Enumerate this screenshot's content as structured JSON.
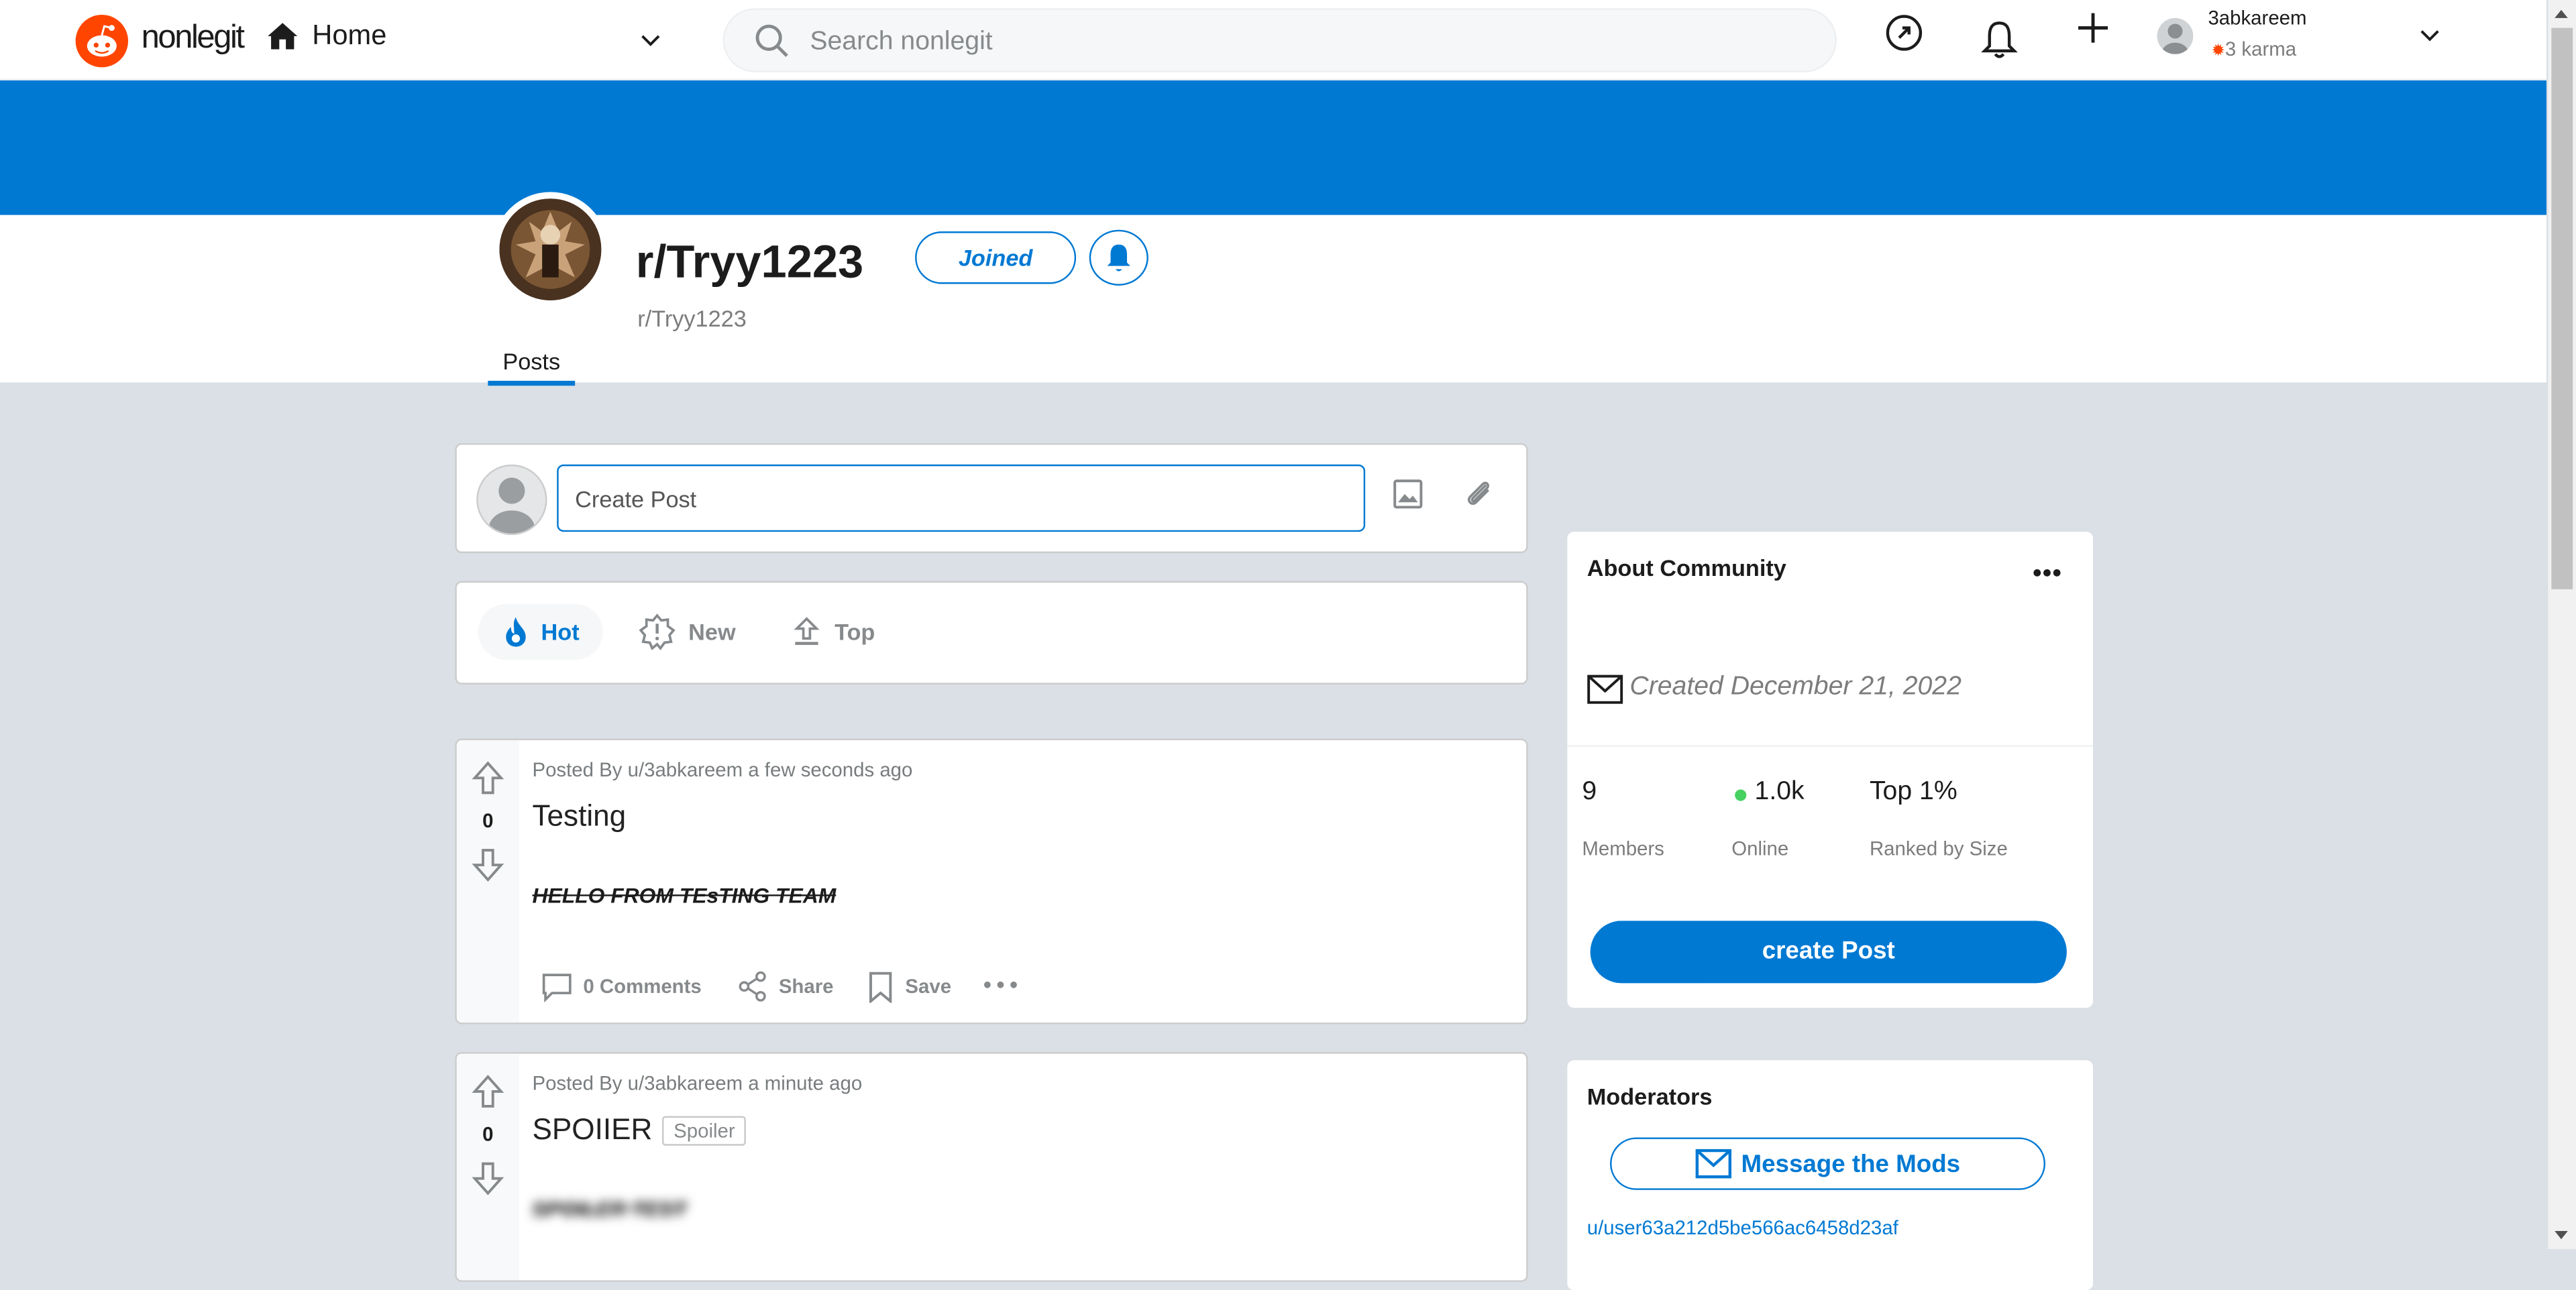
{
  "header": {
    "logo_text": "nonlegit",
    "home_label": "Home",
    "search_placeholder": "Search nonlegit",
    "username": "3abkareem",
    "karma": "3 karma"
  },
  "community": {
    "title": "r/Tryy1223",
    "name": "r/Tryy1223",
    "joined_label": "Joined",
    "tab_posts": "Posts"
  },
  "create_post": {
    "placeholder": "Create Post"
  },
  "sort": {
    "hot": "Hot",
    "new": "New",
    "top": "Top"
  },
  "posts": [
    {
      "meta": "Posted By u/3abkareem a few seconds ago",
      "title": "Testing",
      "body": "HELLO FROM TEsTING TEAM",
      "votes": "0",
      "comments": "0 Comments",
      "share": "Share",
      "save": "Save"
    },
    {
      "meta": "Posted By u/3abkareem a minute ago",
      "title": "SPOIIER",
      "tag": "Spoiler",
      "body": "SPOILER TEST",
      "votes": "0"
    }
  ],
  "about": {
    "title": "About Community",
    "created": "Created December 21, 2022",
    "members_num": "9",
    "members_lbl": "Members",
    "online_num": "1.0k",
    "online_lbl": "Online",
    "rank_num": "Top 1%",
    "rank_lbl": "Ranked by Size",
    "create_post_btn": "create Post"
  },
  "moderators": {
    "title": "Moderators",
    "message_btn": "Message the Mods",
    "mod_user": "u/user63a212d5be566ac6458d23af"
  },
  "colors": {
    "brand": "#ff4500",
    "accent": "#0079d3",
    "online": "#46d160"
  }
}
